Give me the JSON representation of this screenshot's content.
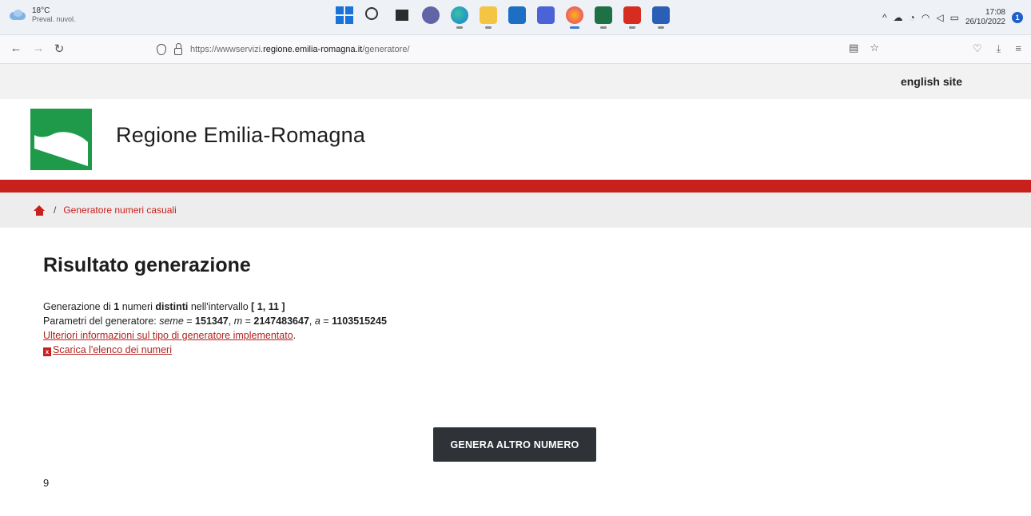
{
  "taskbar": {
    "weather": {
      "temperature": "18°C",
      "condition": "Preval. nuvol."
    },
    "apps": [
      "start",
      "search",
      "task-view",
      "chat",
      "edge",
      "file-explorer",
      "mail",
      "ms-app",
      "firefox",
      "excel",
      "acrobat",
      "word"
    ],
    "clock": {
      "time": "17:08",
      "date": "26/10/2022"
    },
    "notifications": "1"
  },
  "browser": {
    "url_prefix": "https://wwwservizi.",
    "url_host": "regione.emilia-romagna.it",
    "url_path": "/generatore/"
  },
  "page": {
    "english_link": "english site",
    "site_title": "Regione Emilia-Romagna",
    "breadcrumb": {
      "separator": "/",
      "current": "Generatore numeri casuali"
    },
    "heading": "Risultato generazione",
    "line1": {
      "prefix": "Generazione di ",
      "count": "1",
      "mid1": " numeri ",
      "kind": "distinti",
      "mid2": " nell'intervallo ",
      "interval": "[ 1, 11 ]"
    },
    "line2": {
      "prefix": "Parametri del generatore: ",
      "seed_label": "seme",
      "seed_value": "151347",
      "m_label": "m",
      "m_value": "2147483647",
      "a_label": "a",
      "a_value": "1103515245"
    },
    "more_info_link": "Ulteriori informazioni sul tipo di generatore implementato",
    "download_link": "Scarica l'elenco dei numeri",
    "generate_button": "GENERA ALTRO NUMERO",
    "results": [
      "9"
    ]
  },
  "colors": {
    "brand_red": "#c8201d",
    "logo_green": "#1e9a4a",
    "button_dark": "#2f3338"
  }
}
